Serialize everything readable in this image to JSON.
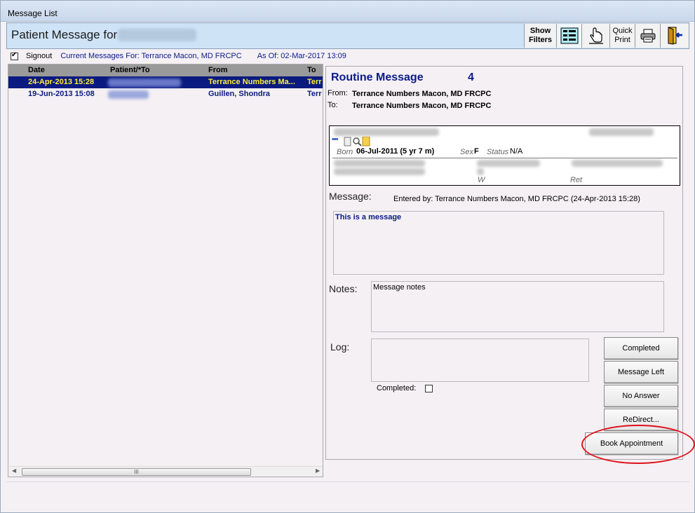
{
  "window": {
    "title": "Message List"
  },
  "header": {
    "title": "Patient Message for",
    "toolbar": {
      "show_filters": "Show Filters",
      "quick_print": "Quick Print"
    }
  },
  "signout": {
    "checked": true,
    "label": "Signout",
    "current_messages": "Current Messages For: Terrance Macon, MD FRCPC",
    "as_of": "As Of: 02-Mar-2017 13:09"
  },
  "list": {
    "columns": [
      "Date",
      "Patient/*To",
      "From",
      "To"
    ],
    "rows": [
      {
        "date": "24-Apr-2013 15:28",
        "from": "Terrance Numbers Ma...",
        "to": "Terr",
        "selected": true
      },
      {
        "date": "19-Jun-2013 15:08",
        "from": "Guillen, Shondra",
        "to": "Terr",
        "selected": false
      }
    ],
    "scroll_thumb": "III"
  },
  "message": {
    "type": "Routine Message",
    "count": "4",
    "from_label": "From:",
    "from": "Terrance Numbers Macon, MD FRCPC",
    "to_label": "To:",
    "to": "Terrance Numbers Macon, MD FRCPC",
    "patient": {
      "born_label": "Born",
      "born": "06-Jul-2011 (5 yr 7 m)",
      "sex_label": "Sex",
      "sex": "F",
      "status_label": "Status",
      "status": "N/A",
      "w_label": "W",
      "ret_label": "Ret"
    },
    "message_label": "Message:",
    "entered_by": "Entered by: Terrance Numbers Macon, MD FRCPC (24-Apr-2013 15:28)",
    "message_text": "This is a message",
    "notes_label": "Notes:",
    "notes_text": "Message notes",
    "log_label": "Log:",
    "completed_label": "Completed:",
    "buttons": {
      "completed": "Completed",
      "message_left": "Message Left",
      "no_answer": "No Answer",
      "redirect": "ReDirect...",
      "book_appointment": "Book Appointment"
    }
  },
  "colors": {
    "selected_row_bg": "#0a1a80",
    "selected_row_text": "#ffef3a",
    "highlight_oval": "#e0101a"
  }
}
